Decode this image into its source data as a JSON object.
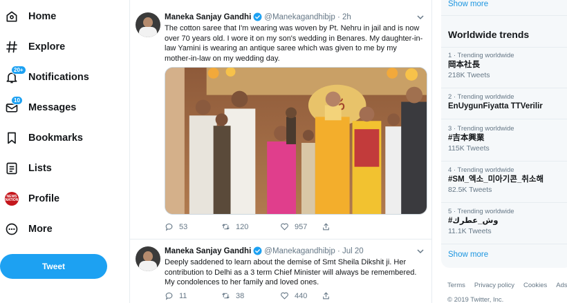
{
  "nav": {
    "items": [
      {
        "label": "Home",
        "icon": "home-icon"
      },
      {
        "label": "Explore",
        "icon": "hashtag-icon"
      },
      {
        "label": "Notifications",
        "icon": "bell-icon",
        "badge": "20+"
      },
      {
        "label": "Messages",
        "icon": "envelope-icon",
        "badge": "10"
      },
      {
        "label": "Bookmarks",
        "icon": "bookmark-icon"
      },
      {
        "label": "Lists",
        "icon": "list-icon"
      },
      {
        "label": "Profile",
        "icon": "profile-avatar-icon",
        "avatar_text": "NEWS NATION"
      },
      {
        "label": "More",
        "icon": "more-dots-icon"
      }
    ],
    "tweet_button": "Tweet"
  },
  "tweets": [
    {
      "name": "Maneka Sanjay Gandhi",
      "handle": "@Manekagandhibjp",
      "time": "· 2h",
      "text": "The cotton saree that I'm wearing was woven by Pt. Nehru in jail and is now over 70 years old. I wore it on my son's wedding in Benares. My daughter-in-law Yamini is wearing an antique saree which was given to me by my mother-in-law on my wedding day.",
      "replies": "53",
      "retweets": "120",
      "likes": "957"
    },
    {
      "name": "Maneka Sanjay Gandhi",
      "handle": "@Manekagandhibjp",
      "time": "· Jul 20",
      "text": "Deeply saddened to learn about the demise of Smt Sheila Dikshit ji. Her contribution to Delhi as a 3 term Chief Minister will always be remembered. My condolences to her family and loved ones.",
      "replies": "11",
      "retweets": "38",
      "likes": "440"
    }
  ],
  "sidebar": {
    "top_show_more": "Show more",
    "trends_title": "Worldwide trends",
    "trends": [
      {
        "meta": "1 · Trending worldwide",
        "name": "岡本社長",
        "count": "218K Tweets"
      },
      {
        "meta": "2 · Trending worldwide",
        "name": "EnUygunFiyatta TTVerilir",
        "count": ""
      },
      {
        "meta": "3 · Trending worldwide",
        "name": "#吉本興業",
        "count": "115K Tweets"
      },
      {
        "meta": "4 · Trending worldwide",
        "name": "#SM_엑소_미아기콘_취소해",
        "count": "82.5K Tweets"
      },
      {
        "meta": "5 · Trending worldwide",
        "name": "#وش_عطرك",
        "count": "11.1K Tweets"
      }
    ],
    "bottom_show_more": "Show more",
    "footer_links": [
      "Terms",
      "Privacy policy",
      "Cookies",
      "Ads info"
    ],
    "copyright": "© 2019 Twitter, Inc."
  },
  "colors": {
    "accent": "#1da1f2",
    "link": "#1b95e0",
    "text": "#14171a",
    "muted": "#657786"
  }
}
